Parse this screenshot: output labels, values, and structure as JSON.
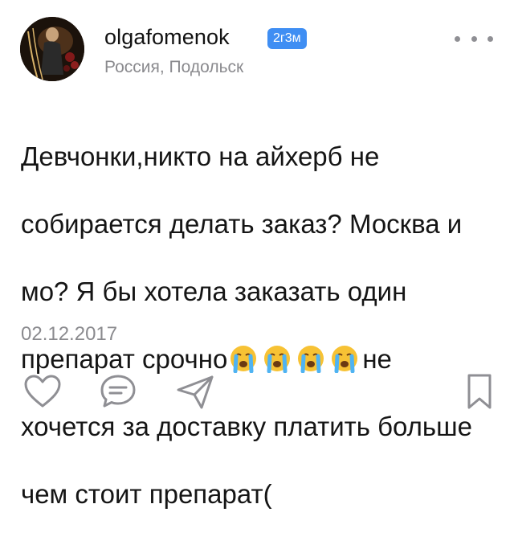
{
  "author": {
    "username": "olgafomenok",
    "time_badge": "2г3м",
    "location": "Россия, Подольск"
  },
  "post": {
    "lines": [
      "Девчонки,никто на айхерб не",
      "собирается делать заказ? Москва и",
      "мо? Я бы хотела заказать один",
      "препарат срочно",
      "не",
      "хочется за доставку платить больше",
      "чем стоит препарат("
    ],
    "emoji": [
      "crying-face-emoji",
      "crying-face-emoji",
      "crying-face-emoji",
      "crying-face-emoji"
    ],
    "date": "02.12.2017"
  },
  "icons": {
    "more": "more-options-icon",
    "like": "heart-icon",
    "comment": "comment-icon",
    "share": "send-icon",
    "bookmark": "bookmark-icon"
  },
  "colors": {
    "badge": "#3f8ef3",
    "secondary_text": "#8a8a8e",
    "icon_stroke": "#8f8f94"
  }
}
